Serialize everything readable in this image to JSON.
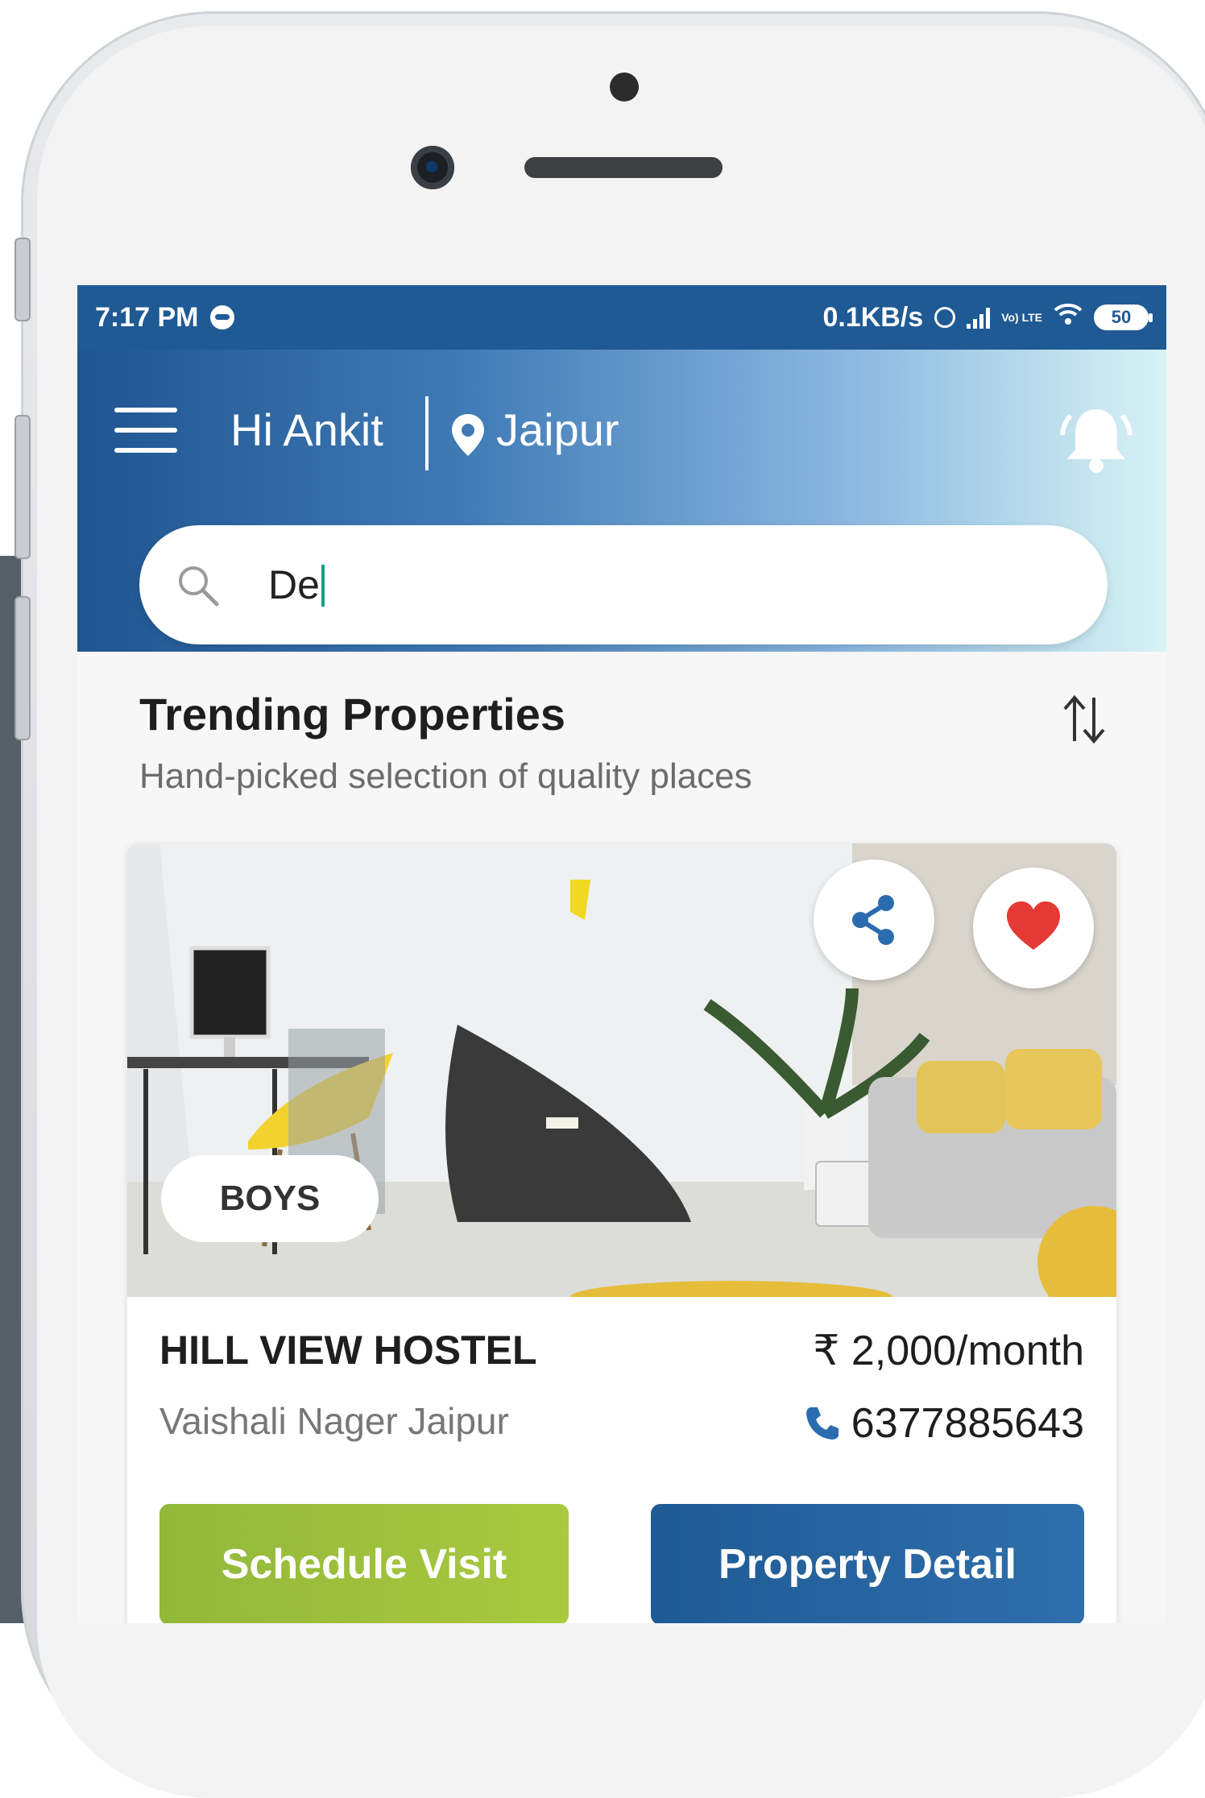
{
  "status_bar": {
    "time": "7:17 PM",
    "network_speed": "0.1KB/s",
    "lte_label": "Vo) LTE",
    "battery": "50"
  },
  "header": {
    "greeting": "Hi Ankit",
    "city": "Jaipur"
  },
  "search": {
    "value": "De"
  },
  "section": {
    "title": "Trending Properties",
    "subtitle": "Hand-picked selection of quality places"
  },
  "property": {
    "tag": "BOYS",
    "name": "HILL VIEW HOSTEL",
    "location": "Vaishali Nager Jaipur",
    "price": "₹ 2,000/month",
    "phone": "6377885643",
    "schedule_label": "Schedule Visit",
    "detail_label": "Property Detail"
  },
  "icons": {
    "menu": "hamburger-menu-icon",
    "location": "map-pin-icon",
    "notification": "bell-icon",
    "search": "search-icon",
    "sort": "sort-icon",
    "share": "share-icon",
    "favorite": "heart-icon",
    "phone": "phone-icon"
  },
  "colors": {
    "brand_blue": "#1f5a94",
    "accent_green": "#a9c93f",
    "favorite_red": "#e53935"
  }
}
